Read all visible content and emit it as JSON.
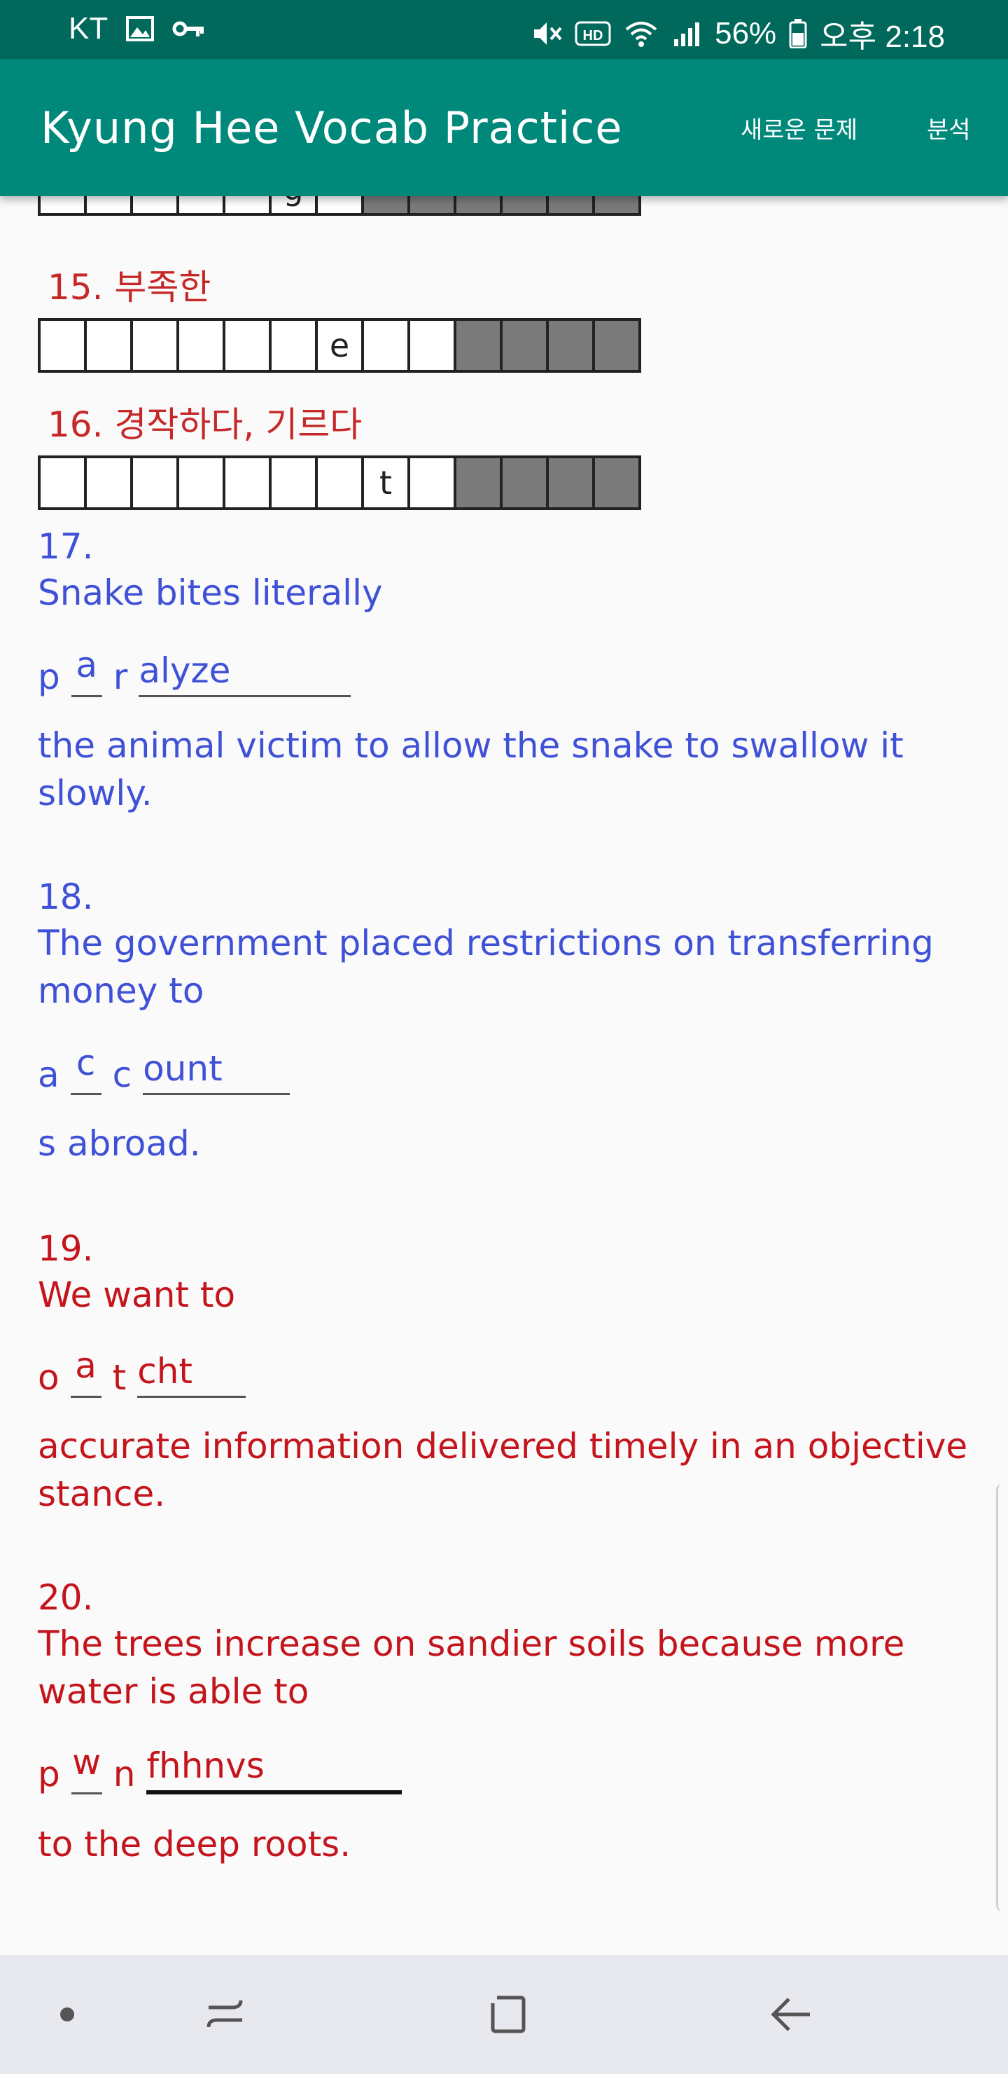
{
  "status_bar": {
    "carrier": "KT",
    "battery": "56%",
    "time": "오후 2:18",
    "icons": [
      "image-icon",
      "key-icon",
      "mute-icon",
      "hd-icon",
      "wifi-icon",
      "signal-icon",
      "battery-icon"
    ]
  },
  "app_bar": {
    "title": "Kyung Hee Vocab Practice",
    "menu_new": "새로운 문제",
    "menu_analysis": "분석"
  },
  "grid14": {
    "letter": "g"
  },
  "q15": {
    "label": "15. 부족한",
    "letter": "e"
  },
  "q16": {
    "label": "16. 경작하다, 기르다",
    "letter": "t"
  },
  "q17": {
    "number": "17.",
    "sentence_start": "Snake bites literally",
    "ans_a": "p",
    "ans_input": "a",
    "ans_b": "r",
    "ans_rest": "alyze",
    "sentence_end": " the animal victim to allow the snake to swallow it slowly."
  },
  "q18": {
    "number": "18.",
    "sentence_start": "The government placed restrictions on transferring money to",
    "ans_a": "a",
    "ans_input": "c",
    "ans_b": "c",
    "ans_rest": "ount",
    "sentence_end": " s abroad."
  },
  "q19": {
    "number": "19.",
    "sentence_start": "We want to",
    "ans_a": "o",
    "ans_input": "a",
    "ans_b": "t",
    "ans_rest": "cht",
    "sentence_end": " accurate information delivered timely in an objective stance."
  },
  "q20": {
    "number": "20.",
    "sentence_start": "The trees increase on sandier soils because more water is able to",
    "ans_a": "p",
    "ans_input": "w",
    "ans_b": "n",
    "ans_rest": "fhhnvs",
    "sentence_end": " to the deep roots."
  },
  "colors": {
    "status_bar": "#00695c",
    "app_bar": "#00897b",
    "blue_text": "#3f51d6",
    "red_text": "#c4141c"
  }
}
